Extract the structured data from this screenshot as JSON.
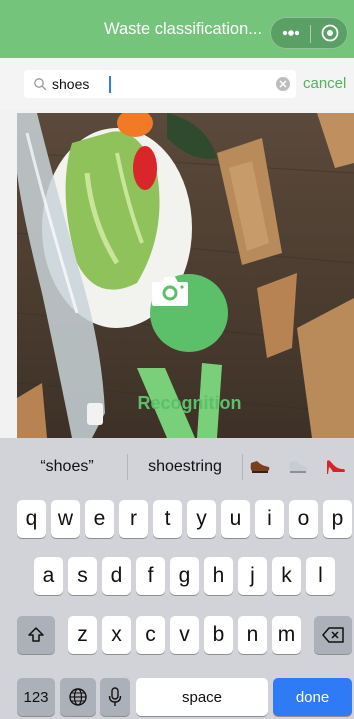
{
  "header": {
    "title": "Waste classification..."
  },
  "search": {
    "query": "shoes",
    "cancel_label": "cancel"
  },
  "hero": {
    "recognition_label": "Recognition"
  },
  "keyboard": {
    "suggestions": [
      "“shoes”",
      "shoestring"
    ],
    "emoji": [
      "shoe-brown-icon",
      "sneaker-icon",
      "high-heel-icon"
    ],
    "row1": [
      "q",
      "w",
      "e",
      "r",
      "t",
      "y",
      "u",
      "i",
      "o",
      "p"
    ],
    "row2": [
      "a",
      "s",
      "d",
      "f",
      "g",
      "h",
      "j",
      "k",
      "l"
    ],
    "row3": [
      "z",
      "x",
      "c",
      "v",
      "b",
      "n",
      "m"
    ],
    "numbers_label": "123",
    "space_label": "space",
    "done_label": "done"
  },
  "colors": {
    "accent": "#74c47b",
    "primary_green": "#5cbf6a",
    "done_blue": "#2f7bf5"
  }
}
